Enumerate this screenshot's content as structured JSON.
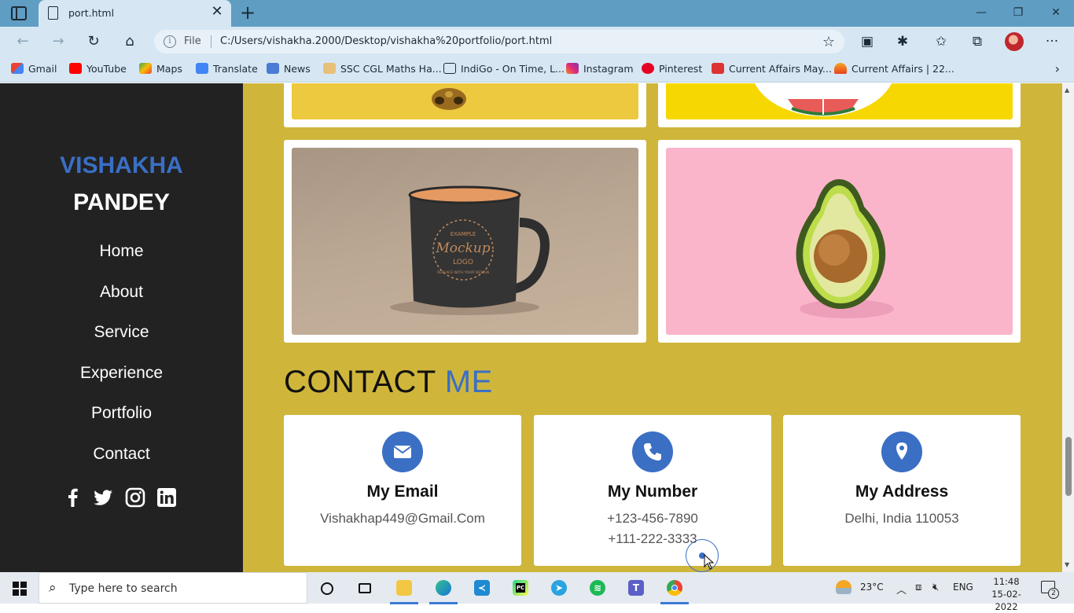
{
  "browser": {
    "tab_title": "port.html",
    "url_scheme": "File",
    "url": "C:/Users/vishakha.2000/Desktop/vishakha%20portfolio/port.html",
    "bookmarks": [
      "Gmail",
      "YouTube",
      "Maps",
      "Translate",
      "News",
      "SSC CGL Maths Ha...",
      "IndiGo - On Time, L...",
      "Instagram",
      "Pinterest",
      "Current Affairs May...",
      "Current Affairs | 22..."
    ]
  },
  "sidebar": {
    "brand_first": "VISHAKHA",
    "brand_last": "PANDEY",
    "nav": [
      "Home",
      "About",
      "Service",
      "Experience",
      "Portfolio",
      "Contact"
    ],
    "social_icons": [
      "facebook-icon",
      "twitter-icon",
      "instagram-icon",
      "linkedin-icon"
    ]
  },
  "portfolio": {
    "images": [
      "pineapple-image",
      "watermelon-image",
      "mockup-mug-image",
      "avocado-image"
    ],
    "mug_print": [
      "EXAMPLE",
      "Mockup",
      "LOGO",
      "REPLACE WITH YOUR DESIGN"
    ]
  },
  "contact": {
    "title_main": "CONTACT",
    "title_accent": "ME",
    "cards": [
      {
        "title": "My Email",
        "lines": [
          "Vishakhap449@Gmail.Com"
        ],
        "icon": "envelope-icon"
      },
      {
        "title": "My Number",
        "lines": [
          "+123-456-7890",
          "+111-222-3333"
        ],
        "icon": "phone-icon"
      },
      {
        "title": "My Address",
        "lines": [
          "Delhi, India 110053"
        ],
        "icon": "map-marker-icon"
      }
    ]
  },
  "taskbar": {
    "search_placeholder": "Type here to search",
    "temperature": "23°C",
    "language": "ENG",
    "time": "11:48",
    "date": "15-02-2022",
    "notification_count": "2"
  },
  "colors": {
    "accent": "#3a6fc4",
    "sidebar_bg": "#222222",
    "main_bg": "#cfb63b"
  }
}
